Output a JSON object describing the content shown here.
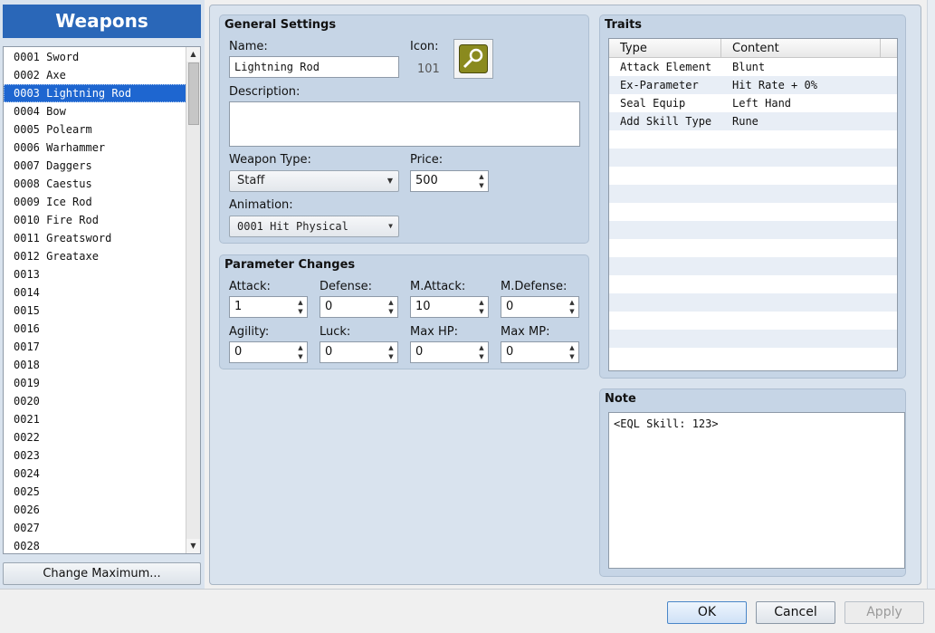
{
  "left_panel": {
    "header": "Weapons",
    "items": [
      "0001 Sword",
      "0002 Axe",
      "0003 Lightning Rod",
      "0004 Bow",
      "0005 Polearm",
      "0006 Warhammer",
      "0007 Daggers",
      "0008 Caestus",
      "0009 Ice Rod",
      "0010 Fire Rod",
      "0011 Greatsword",
      "0012 Greataxe",
      "0013",
      "0014",
      "0015",
      "0016",
      "0017",
      "0018",
      "0019",
      "0020",
      "0021",
      "0022",
      "0023",
      "0024",
      "0025",
      "0026",
      "0027",
      "0028"
    ],
    "selected_index": 2,
    "change_maximum_label": "Change Maximum..."
  },
  "general": {
    "title": "General Settings",
    "name_label": "Name:",
    "name_value": "Lightning Rod",
    "icon_label": "Icon:",
    "icon_index": "101",
    "icon_name": "magnifier-rod-icon",
    "description_label": "Description:",
    "description_value": "",
    "weapon_type_label": "Weapon Type:",
    "weapon_type_value": "Staff",
    "price_label": "Price:",
    "price_value": "500",
    "animation_label": "Animation:",
    "animation_value": "0001 Hit Physical"
  },
  "params": {
    "title": "Parameter Changes",
    "attack_label": "Attack:",
    "attack_value": "1",
    "defense_label": "Defense:",
    "defense_value": "0",
    "mattack_label": "M.Attack:",
    "mattack_value": "10",
    "mdefense_label": "M.Defense:",
    "mdefense_value": "0",
    "agility_label": "Agility:",
    "agility_value": "0",
    "luck_label": "Luck:",
    "luck_value": "0",
    "maxhp_label": "Max HP:",
    "maxhp_value": "0",
    "maxmp_label": "Max MP:",
    "maxmp_value": "0"
  },
  "traits": {
    "title": "Traits",
    "col_type": "Type",
    "col_content": "Content",
    "rows": [
      {
        "type": "Attack Element",
        "content": "Blunt"
      },
      {
        "type": "Ex-Parameter",
        "content": "Hit Rate + 0%"
      },
      {
        "type": "Seal Equip",
        "content": "Left Hand"
      },
      {
        "type": "Add Skill Type",
        "content": "Rune"
      }
    ]
  },
  "note": {
    "title": "Note",
    "text": "<EQL Skill: 123>"
  },
  "footer": {
    "ok": "OK",
    "cancel": "Cancel",
    "apply": "Apply"
  },
  "colors": {
    "accent": "#2a67b8",
    "selection": "#1e66d0",
    "panel_bg": "#d9e3ee",
    "group_bg": "#c6d5e6"
  }
}
